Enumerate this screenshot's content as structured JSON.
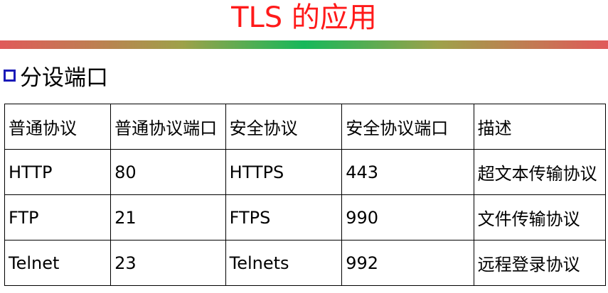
{
  "title": "TLS 的应用",
  "colors": {
    "title": "#ff1a1a",
    "bullet": "#1a1ab8"
  },
  "section": {
    "bullet_icon": "hollow-square-bullet",
    "heading": "分设端口"
  },
  "table": {
    "headers": [
      "普通协议",
      "普通协议端口",
      "安全协议",
      "安全协议端口",
      "描述"
    ],
    "rows": [
      [
        "HTTP",
        "80",
        "HTTPS",
        "443",
        "超文本传输协议"
      ],
      [
        "FTP",
        "21",
        "FTPS",
        "990",
        "文件传输协议"
      ],
      [
        "Telnet",
        "23",
        "Telnets",
        "992",
        "远程登录协议"
      ]
    ]
  }
}
